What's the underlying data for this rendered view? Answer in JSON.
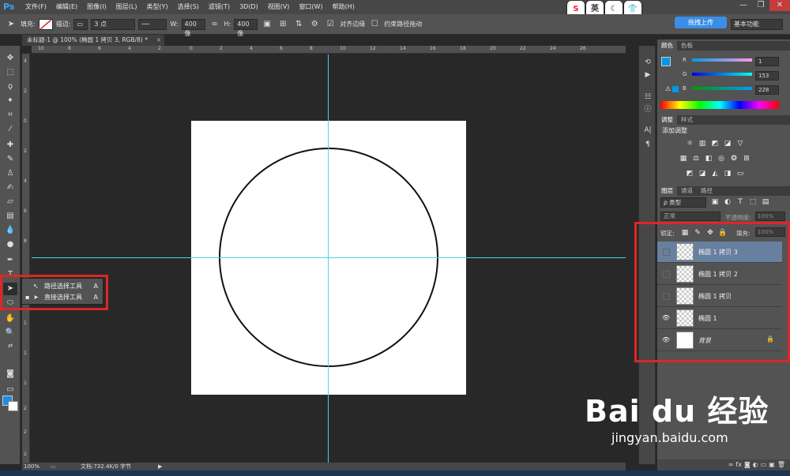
{
  "app": {
    "logo": "Ps"
  },
  "menu": [
    "文件(F)",
    "编辑(E)",
    "图像(I)",
    "图层(L)",
    "类型(Y)",
    "选择(S)",
    "滤镜(T)",
    "3D(D)",
    "视图(V)",
    "窗口(W)",
    "帮助(H)"
  ],
  "ime": [
    "英"
  ],
  "options": {
    "fill_label": "填充:",
    "stroke_label": "描边:",
    "stroke_width": "3 点",
    "w_label": "W:",
    "w_value": "400 像",
    "h_label": "H:",
    "h_value": "400 像",
    "align_edges": "对齐边缘",
    "constrain_path": "约束路径拖动",
    "upload": "拖拽上传",
    "workspace": "基本功能"
  },
  "document": {
    "tab_title": "未标题-1 @ 100% (椭圆 1 拷贝 3, RGB/8) *",
    "zoom": "100%",
    "doc_size": "文档:732.4K/0 字节"
  },
  "ruler_top": [
    "10",
    "8",
    "6",
    "4",
    "2",
    "0",
    "2",
    "4",
    "6",
    "8",
    "10",
    "12",
    "14",
    "16",
    "18",
    "20",
    "22",
    "24",
    "26"
  ],
  "ruler_left": [
    "4",
    "2",
    "0",
    "2",
    "4",
    "6",
    "8",
    "1",
    "1",
    "1",
    "1",
    "2",
    "2",
    "2"
  ],
  "flyout": {
    "items": [
      {
        "label": "路径选择工具",
        "shortcut": "A",
        "icon": "path-selection-icon"
      },
      {
        "label": "直接选择工具",
        "shortcut": "A",
        "icon": "direct-selection-icon"
      }
    ]
  },
  "color_panel": {
    "tabs": [
      "颜色",
      "色板"
    ],
    "r_label": "R",
    "g_label": "G",
    "b_label": "B",
    "r_value": "1",
    "g_value": "153",
    "b_value": "228",
    "fg_color": "#0199e4"
  },
  "adjust_panel": {
    "tabs": [
      "调整",
      "样式"
    ],
    "title": "添加调整"
  },
  "layers_panel": {
    "tabs": [
      "图层",
      "通道",
      "路径"
    ],
    "filter_label": "ρ 类型",
    "blend_mode": "正常",
    "opacity_label": "不透明度:",
    "opacity_value": "100%",
    "lock_label": "锁定:",
    "fill_label": "填充:",
    "fill_value": "100%",
    "layers": [
      {
        "name": "椭圆 1 拷贝 3",
        "visible": false,
        "selected": true
      },
      {
        "name": "椭圆 1 拷贝 2",
        "visible": false,
        "selected": false
      },
      {
        "name": "椭圆 1 拷贝",
        "visible": false,
        "selected": false
      },
      {
        "name": "椭圆 1",
        "visible": true,
        "selected": false
      },
      {
        "name": "背景",
        "visible": true,
        "selected": false,
        "locked": true
      }
    ]
  },
  "watermark": {
    "brand": "Bai du 经验",
    "url": "jingyan.baidu.com"
  }
}
